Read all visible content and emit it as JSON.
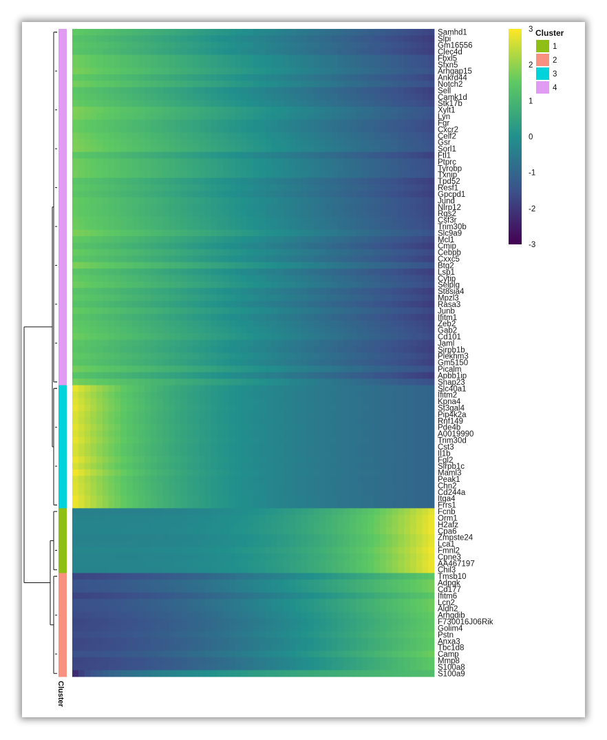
{
  "chart_data": {
    "type": "heatmap",
    "rows": [
      {
        "gene": "Samhd1",
        "cluster": 4
      },
      {
        "gene": "Slpi",
        "cluster": 4
      },
      {
        "gene": "Gm16556",
        "cluster": 4
      },
      {
        "gene": "Clec4d",
        "cluster": 4
      },
      {
        "gene": "Fbxl5",
        "cluster": 4
      },
      {
        "gene": "Sfxn5",
        "cluster": 4
      },
      {
        "gene": "Arhgap15",
        "cluster": 4
      },
      {
        "gene": "Ankrd44",
        "cluster": 4
      },
      {
        "gene": "Notch2",
        "cluster": 4
      },
      {
        "gene": "Sell",
        "cluster": 4
      },
      {
        "gene": "Camk1d",
        "cluster": 4
      },
      {
        "gene": "Stk17b",
        "cluster": 4
      },
      {
        "gene": "Xylt1",
        "cluster": 4
      },
      {
        "gene": "Lyn",
        "cluster": 4
      },
      {
        "gene": "Fgr",
        "cluster": 4
      },
      {
        "gene": "Cxcr2",
        "cluster": 4
      },
      {
        "gene": "Celf2",
        "cluster": 4
      },
      {
        "gene": "Gsr",
        "cluster": 4
      },
      {
        "gene": "Sorl1",
        "cluster": 4
      },
      {
        "gene": "Ftl1",
        "cluster": 4
      },
      {
        "gene": "Ptprc",
        "cluster": 4
      },
      {
        "gene": "Tyrobp",
        "cluster": 4
      },
      {
        "gene": "Txnip",
        "cluster": 4
      },
      {
        "gene": "Tpd52",
        "cluster": 4
      },
      {
        "gene": "Resf1",
        "cluster": 4
      },
      {
        "gene": "Gpcpd1",
        "cluster": 4
      },
      {
        "gene": "Jund",
        "cluster": 4
      },
      {
        "gene": "Nlrp12",
        "cluster": 4
      },
      {
        "gene": "Rgs2",
        "cluster": 4
      },
      {
        "gene": "Csf3r",
        "cluster": 4
      },
      {
        "gene": "Trim30b",
        "cluster": 4
      },
      {
        "gene": "Slc9a9",
        "cluster": 4
      },
      {
        "gene": "Mcl1",
        "cluster": 4
      },
      {
        "gene": "Cmip",
        "cluster": 4
      },
      {
        "gene": "Cebpb",
        "cluster": 4
      },
      {
        "gene": "Cxxc5",
        "cluster": 4
      },
      {
        "gene": "Btg2",
        "cluster": 4
      },
      {
        "gene": "Lsp1",
        "cluster": 4
      },
      {
        "gene": "Cytip",
        "cluster": 4
      },
      {
        "gene": "Selplg",
        "cluster": 4
      },
      {
        "gene": "St8sia4",
        "cluster": 4
      },
      {
        "gene": "Mpzl3",
        "cluster": 4
      },
      {
        "gene": "Rasa3",
        "cluster": 4
      },
      {
        "gene": "Junb",
        "cluster": 4
      },
      {
        "gene": "Ifitm1",
        "cluster": 4
      },
      {
        "gene": "Zeb2",
        "cluster": 4
      },
      {
        "gene": "Gab2",
        "cluster": 4
      },
      {
        "gene": "Cd101",
        "cluster": 4
      },
      {
        "gene": "Jaml",
        "cluster": 4
      },
      {
        "gene": "Sirpb1b",
        "cluster": 4
      },
      {
        "gene": "Plekhm3",
        "cluster": 4
      },
      {
        "gene": "Gm5150",
        "cluster": 4
      },
      {
        "gene": "Picalm",
        "cluster": 4
      },
      {
        "gene": "Apbb1ip",
        "cluster": 4
      },
      {
        "gene": "Snap23",
        "cluster": 4
      },
      {
        "gene": "Slc40a1",
        "cluster": 3
      },
      {
        "gene": "Ifitm2",
        "cluster": 3
      },
      {
        "gene": "Kpna4",
        "cluster": 3
      },
      {
        "gene": "St3gal4",
        "cluster": 3
      },
      {
        "gene": "Pip4k2a",
        "cluster": 3
      },
      {
        "gene": "Rnf149",
        "cluster": 3
      },
      {
        "gene": "Pde4b",
        "cluster": 3
      },
      {
        "gene": "A0019990",
        "cluster": 3
      },
      {
        "gene": "Trim30d",
        "cluster": 3
      },
      {
        "gene": "Cst3",
        "cluster": 3
      },
      {
        "gene": "Il1b",
        "cluster": 3
      },
      {
        "gene": "Fgl2",
        "cluster": 3
      },
      {
        "gene": "Sirpb1c",
        "cluster": 3
      },
      {
        "gene": "Maml3",
        "cluster": 3
      },
      {
        "gene": "Peak1",
        "cluster": 3
      },
      {
        "gene": "Chn2",
        "cluster": 3
      },
      {
        "gene": "Cd244a",
        "cluster": 3
      },
      {
        "gene": "Itga4",
        "cluster": 3
      },
      {
        "gene": "Frrs1",
        "cluster": 3
      },
      {
        "gene": "Fcnb",
        "cluster": 1
      },
      {
        "gene": "Orm1",
        "cluster": 1
      },
      {
        "gene": "H2afz",
        "cluster": 1
      },
      {
        "gene": "Cpa6",
        "cluster": 1
      },
      {
        "gene": "Zmpste24",
        "cluster": 1
      },
      {
        "gene": "Lca1",
        "cluster": 1
      },
      {
        "gene": "Fmnl2",
        "cluster": 1
      },
      {
        "gene": "Cpne3",
        "cluster": 1
      },
      {
        "gene": "AA467197",
        "cluster": 1
      },
      {
        "gene": "Chil3",
        "cluster": 1
      },
      {
        "gene": "Tmsb10",
        "cluster": 2
      },
      {
        "gene": "Adpgk",
        "cluster": 2
      },
      {
        "gene": "Cd177",
        "cluster": 2
      },
      {
        "gene": "Ifitm6",
        "cluster": 2
      },
      {
        "gene": "Lcn2",
        "cluster": 2
      },
      {
        "gene": "Aldh2",
        "cluster": 2
      },
      {
        "gene": "Arhgdib",
        "cluster": 2
      },
      {
        "gene": "F730016J06Rik",
        "cluster": 2
      },
      {
        "gene": "Golim4",
        "cluster": 2
      },
      {
        "gene": "Pstn",
        "cluster": 2
      },
      {
        "gene": "Anxa3",
        "cluster": 2
      },
      {
        "gene": "Tbc1d8",
        "cluster": 2
      },
      {
        "gene": "Camp",
        "cluster": 2
      },
      {
        "gene": "Mmp8",
        "cluster": 2
      },
      {
        "gene": "S100a8",
        "cluster": 2
      },
      {
        "gene": "S100a9",
        "cluster": 2
      }
    ],
    "colorscale": {
      "name": "viridis",
      "range": [
        -3,
        3
      ],
      "ticks": [
        3,
        2,
        1,
        0,
        -1,
        -2,
        -3
      ],
      "stops": [
        "#440154",
        "#3b528b",
        "#21908c",
        "#5dc863",
        "#fde725"
      ]
    },
    "cluster_legend": {
      "title": "Cluster",
      "entries": [
        {
          "label": "1",
          "color": "#8fbf14"
        },
        {
          "label": "2",
          "color": "#f8917f"
        },
        {
          "label": "3",
          "color": "#00d3d9"
        },
        {
          "label": "4",
          "color": "#e09bf2"
        }
      ]
    },
    "cluster_axis_label": "Cluster",
    "x_axis": "pseudotime (unlabeled)",
    "dendrogram": "left",
    "legend_position": "right"
  }
}
